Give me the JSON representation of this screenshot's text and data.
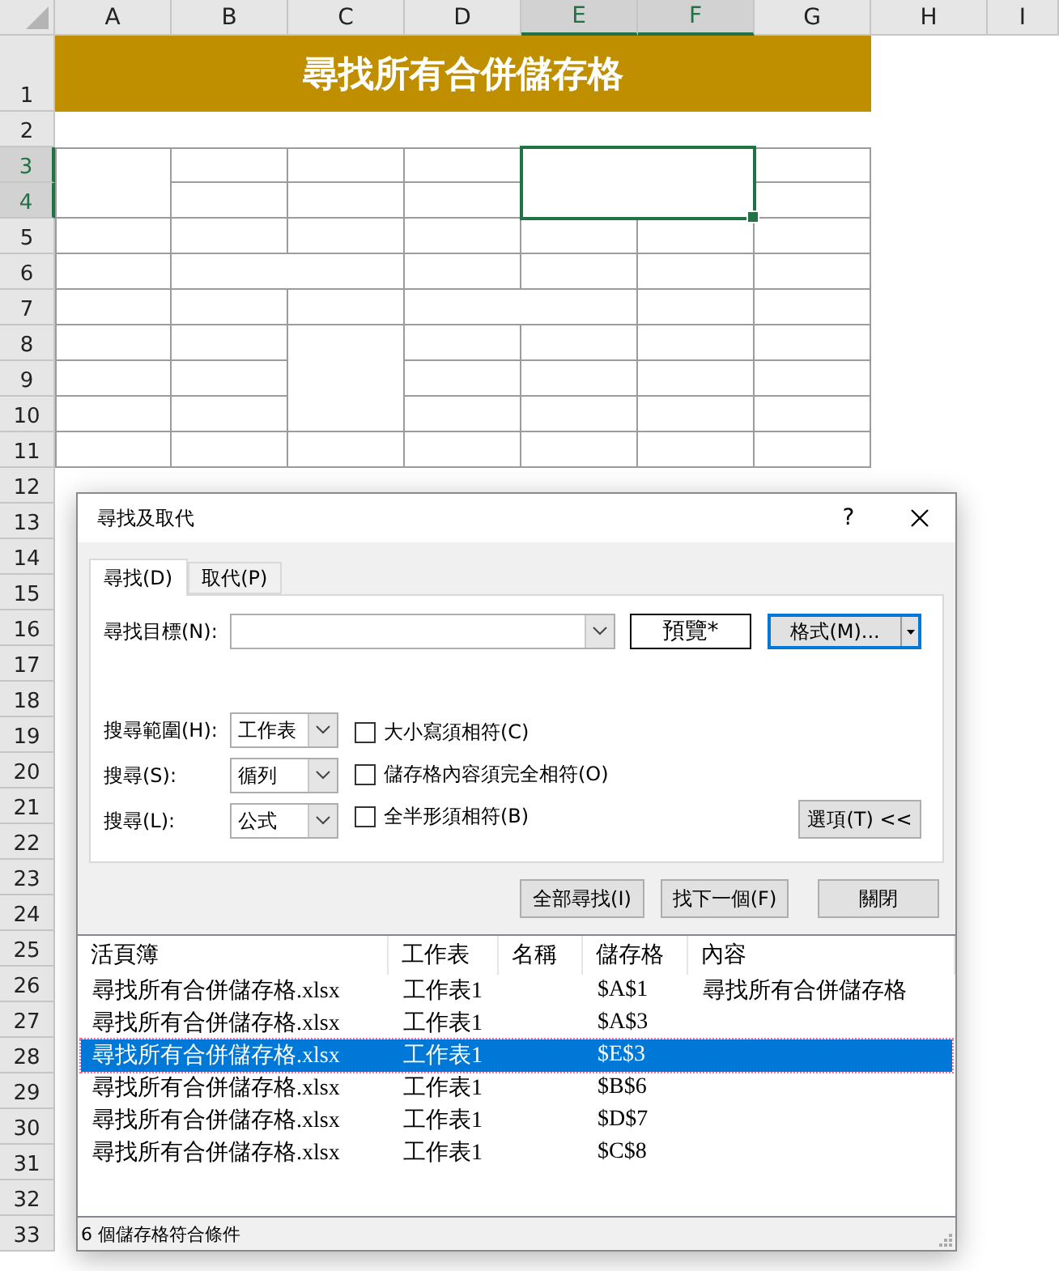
{
  "sheet": {
    "columns": [
      {
        "label": "A",
        "selected": false
      },
      {
        "label": "B",
        "selected": false
      },
      {
        "label": "C",
        "selected": false
      },
      {
        "label": "D",
        "selected": false
      },
      {
        "label": "E",
        "selected": true
      },
      {
        "label": "F",
        "selected": true
      },
      {
        "label": "G",
        "selected": false
      },
      {
        "label": "H",
        "selected": false
      },
      {
        "label": "I",
        "selected": false
      }
    ],
    "rows": [
      {
        "label": "1",
        "selected": false
      },
      {
        "label": "2",
        "selected": false
      },
      {
        "label": "3",
        "selected": true
      },
      {
        "label": "4",
        "selected": true
      },
      {
        "label": "5",
        "selected": false
      },
      {
        "label": "6",
        "selected": false
      },
      {
        "label": "7",
        "selected": false
      },
      {
        "label": "8",
        "selected": false
      },
      {
        "label": "9",
        "selected": false
      },
      {
        "label": "10",
        "selected": false
      },
      {
        "label": "11",
        "selected": false
      },
      {
        "label": "12",
        "selected": false
      },
      {
        "label": "13",
        "selected": false
      },
      {
        "label": "14",
        "selected": false
      },
      {
        "label": "15",
        "selected": false
      },
      {
        "label": "16",
        "selected": false
      },
      {
        "label": "17",
        "selected": false
      },
      {
        "label": "18",
        "selected": false
      },
      {
        "label": "19",
        "selected": false
      },
      {
        "label": "20",
        "selected": false
      },
      {
        "label": "21",
        "selected": false
      },
      {
        "label": "22",
        "selected": false
      },
      {
        "label": "23",
        "selected": false
      },
      {
        "label": "24",
        "selected": false
      },
      {
        "label": "25",
        "selected": false
      },
      {
        "label": "26",
        "selected": false
      },
      {
        "label": "27",
        "selected": false
      },
      {
        "label": "28",
        "selected": false
      },
      {
        "label": "29",
        "selected": false
      },
      {
        "label": "30",
        "selected": false
      },
      {
        "label": "31",
        "selected": false
      },
      {
        "label": "32",
        "selected": false
      },
      {
        "label": "33",
        "selected": false
      }
    ],
    "title": "尋找所有合併儲存格"
  },
  "dialog": {
    "title": "尋找及取代",
    "help": "?",
    "tabs": [
      {
        "label": "尋找(D)",
        "selected": true
      },
      {
        "label": "取代(P)",
        "selected": false
      }
    ],
    "find_what": {
      "label": "尋找目標(N):"
    },
    "preview": "預覽*",
    "format_button": "格式(M)...",
    "options": [
      {
        "label": "搜尋範圍(H):",
        "value": "工作表"
      },
      {
        "label": "搜尋(S):",
        "value": "循列"
      },
      {
        "label": "搜尋(L):",
        "value": "公式"
      }
    ],
    "checkboxes": [
      {
        "label": "大小寫須相符(C)",
        "checked": false
      },
      {
        "label": "儲存格內容須完全相符(O)",
        "checked": false
      },
      {
        "label": "全半形須相符(B)",
        "checked": false
      }
    ],
    "options_button": "選項(T) <<",
    "buttons": [
      "全部尋找(I)",
      "找下一個(F)",
      "關閉"
    ],
    "results": {
      "columns": [
        "活頁簿",
        "工作表",
        "名稱",
        "儲存格",
        "內容"
      ],
      "rows": [
        {
          "cells": [
            "尋找所有合併儲存格.xlsx",
            "工作表1",
            "",
            "$A$1",
            "尋找所有合併儲存格"
          ],
          "selected": false
        },
        {
          "cells": [
            "尋找所有合併儲存格.xlsx",
            "工作表1",
            "",
            "$A$3",
            ""
          ],
          "selected": false
        },
        {
          "cells": [
            "尋找所有合併儲存格.xlsx",
            "工作表1",
            "",
            "$E$3",
            ""
          ],
          "selected": true
        },
        {
          "cells": [
            "尋找所有合併儲存格.xlsx",
            "工作表1",
            "",
            "$B$6",
            ""
          ],
          "selected": false
        },
        {
          "cells": [
            "尋找所有合併儲存格.xlsx",
            "工作表1",
            "",
            "$D$7",
            ""
          ],
          "selected": false
        },
        {
          "cells": [
            "尋找所有合併儲存格.xlsx",
            "工作表1",
            "",
            "$C$8",
            ""
          ],
          "selected": false
        }
      ]
    },
    "status": "6 個儲存格符合條件"
  }
}
